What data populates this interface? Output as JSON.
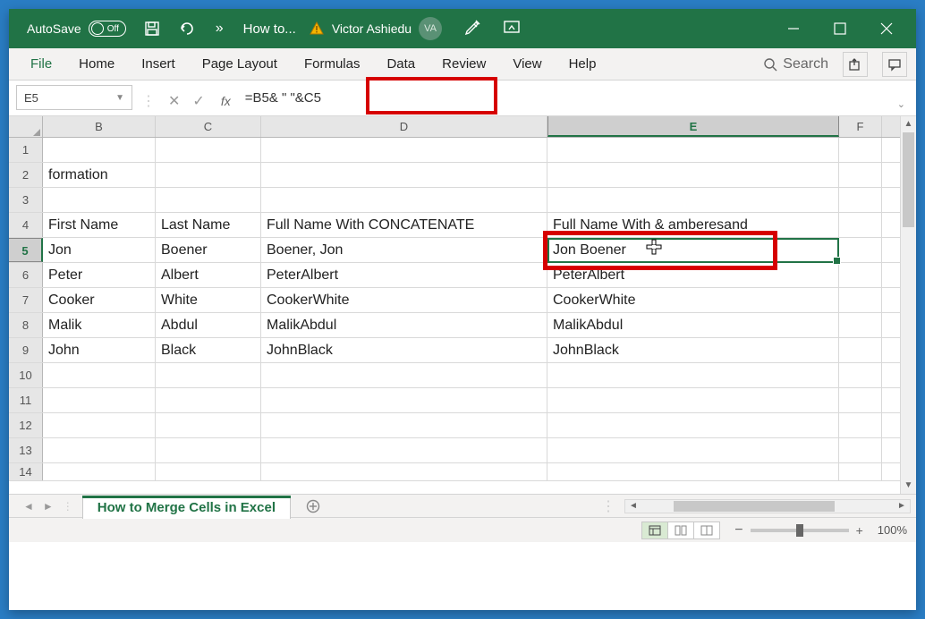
{
  "titlebar": {
    "autosave_label": "AutoSave",
    "autosave_state": "Off",
    "doc_title": "How to...",
    "user_name": "Victor Ashiedu",
    "user_initials": "VA"
  },
  "ribbon": {
    "tabs": [
      "File",
      "Home",
      "Insert",
      "Page Layout",
      "Formulas",
      "Data",
      "Review",
      "View",
      "Help"
    ],
    "search_label": "Search"
  },
  "formula_bar": {
    "name_box": "E5",
    "fx_label": "fx",
    "formula": "=B5& \" \"&C5"
  },
  "grid": {
    "columns": [
      "B",
      "C",
      "D",
      "E",
      "F"
    ],
    "selected_col": "E",
    "selected_row": 5,
    "rows": [
      {
        "n": 1,
        "B": "",
        "C": "",
        "D": "",
        "E": "",
        "F": ""
      },
      {
        "n": 2,
        "B": "formation",
        "C": "",
        "D": "",
        "E": "",
        "F": ""
      },
      {
        "n": 3,
        "B": "",
        "C": "",
        "D": "",
        "E": "",
        "F": ""
      },
      {
        "n": 4,
        "B": "First Name",
        "C": "Last Name",
        "D": "Full Name With CONCATENATE",
        "E": "Full Name With & amberesand",
        "F": ""
      },
      {
        "n": 5,
        "B": "Jon",
        "C": "Boener",
        "D": "Boener, Jon",
        "E": "Jon Boener",
        "F": ""
      },
      {
        "n": 6,
        "B": "Peter",
        "C": "Albert",
        "D": "PeterAlbert",
        "E": "PeterAlbert",
        "F": ""
      },
      {
        "n": 7,
        "B": "Cooker",
        "C": "White",
        "D": "CookerWhite",
        "E": "CookerWhite",
        "F": ""
      },
      {
        "n": 8,
        "B": "Malik",
        "C": "Abdul",
        "D": "MalikAbdul",
        "E": "MalikAbdul",
        "F": ""
      },
      {
        "n": 9,
        "B": "John",
        "C": "Black",
        "D": "JohnBlack",
        "E": "JohnBlack",
        "F": ""
      },
      {
        "n": 10,
        "B": "",
        "C": "",
        "D": "",
        "E": "",
        "F": ""
      },
      {
        "n": 11,
        "B": "",
        "C": "",
        "D": "",
        "E": "",
        "F": ""
      },
      {
        "n": 12,
        "B": "",
        "C": "",
        "D": "",
        "E": "",
        "F": ""
      },
      {
        "n": 13,
        "B": "",
        "C": "",
        "D": "",
        "E": "",
        "F": ""
      },
      {
        "n": 14,
        "B": "",
        "C": "",
        "D": "",
        "E": "",
        "F": ""
      }
    ]
  },
  "sheettabs": {
    "active_sheet": "How to Merge Cells in Excel"
  },
  "statusbar": {
    "zoom": "100%"
  }
}
